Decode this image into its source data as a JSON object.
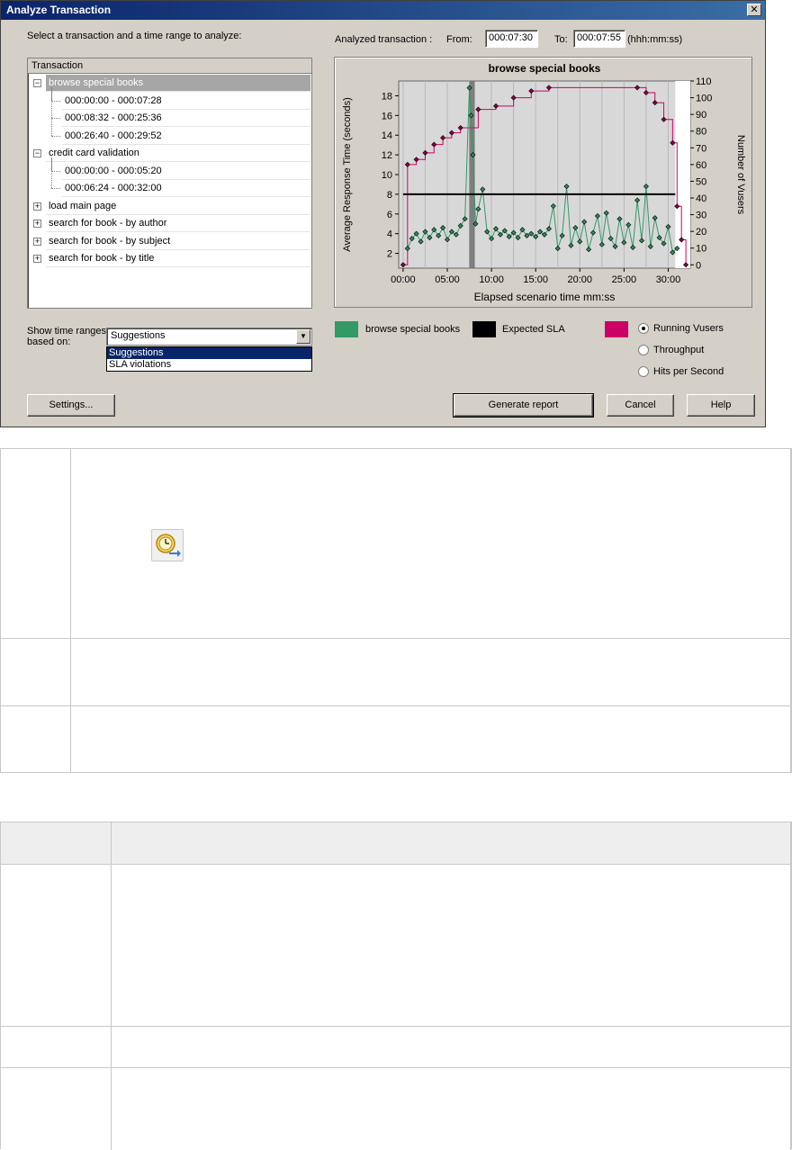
{
  "dialog": {
    "title": "Analyze Transaction",
    "close_label": "✕",
    "instructions": "Select a transaction and a time range to analyze:",
    "analyzed_label": "Analyzed transaction :",
    "from_label": "From:",
    "from_value": "000:07:30",
    "to_label": "To:",
    "to_value": "000:07:55",
    "format_hint": "(hhh:mm:ss)",
    "tree": {
      "header": "Transaction",
      "rows": [
        {
          "label": "browse special books",
          "level": 0,
          "expander": "−",
          "selected": true
        },
        {
          "label": "000:00:00 - 000:07:28",
          "level": 1
        },
        {
          "label": "000:08:32 - 000:25:36",
          "level": 1
        },
        {
          "label": "000:26:40 - 000:29:52",
          "level": 1
        },
        {
          "label": "credit card validation",
          "level": 0,
          "expander": "−"
        },
        {
          "label": "000:00:00 - 000:05:20",
          "level": 1
        },
        {
          "label": "000:06:24 - 000:32:00",
          "level": 1
        },
        {
          "label": "load main page",
          "level": 0,
          "expander": "+"
        },
        {
          "label": "search for book - by author",
          "level": 0,
          "expander": "+"
        },
        {
          "label": "search for book - by subject",
          "level": 0,
          "expander": "+"
        },
        {
          "label": "search for book - by title",
          "level": 0,
          "expander": "+"
        }
      ]
    },
    "show_ranges_label_1": "Show time ranges",
    "show_ranges_label_2": "based on:",
    "combo_value": "Suggestions",
    "dropdown_options": [
      "Suggestions",
      "SLA violations"
    ],
    "legend": {
      "series1": "browse special books",
      "series2": "Expected SLA",
      "series1_color": "#339966",
      "series2_color": "#000000",
      "series3_color": "#cc0066"
    },
    "radios": [
      {
        "label": "Running Vusers",
        "checked": true
      },
      {
        "label": "Throughput",
        "checked": false
      },
      {
        "label": "Hits per Second",
        "checked": false
      }
    ],
    "buttons": {
      "settings": "Settings...",
      "generate": "Generate report",
      "cancel": "Cancel",
      "help": "Help"
    }
  },
  "chart_data": {
    "type": "line",
    "title": "browse special books",
    "xlabel": "Elapsed scenario time mm:ss",
    "ylabel": "Average Response Time (seconds)",
    "y2label": "Number of Vusers",
    "x_ticks": [
      "00:00",
      "05:00",
      "10:00",
      "15:00",
      "20:00",
      "25:00",
      "30:00"
    ],
    "y_ticks": [
      2,
      4,
      6,
      8,
      10,
      12,
      14,
      16,
      18
    ],
    "y2_ticks": [
      0,
      10,
      20,
      30,
      40,
      50,
      60,
      70,
      80,
      90,
      100,
      110
    ],
    "xlim_minutes": [
      -0.5,
      32.5
    ],
    "ylim": [
      0.5,
      19.5
    ],
    "y2lim": [
      -2,
      110
    ],
    "sla_value": 8,
    "highlight_range_minutes": [
      7.5,
      7.92
    ],
    "series": [
      {
        "name": "Running Vusers",
        "axis": "right",
        "color": "#cc0066",
        "x": [
          0,
          0.5,
          1.5,
          2.5,
          3.5,
          4.5,
          5.5,
          6.5,
          8.5,
          10.5,
          12.5,
          14.5,
          16.5,
          26.5,
          27.5,
          28.5,
          29.5,
          30.5,
          31,
          31.5,
          32
        ],
        "y": [
          0,
          60,
          63,
          67,
          72,
          76,
          79,
          82,
          93,
          95,
          100,
          104,
          106,
          106,
          103,
          97,
          87,
          73,
          35,
          15,
          0
        ]
      },
      {
        "name": "browse special books",
        "axis": "left",
        "color": "#339966",
        "x": [
          0.5,
          1,
          1.5,
          2,
          2.5,
          3,
          3.5,
          4,
          4.5,
          5,
          5.5,
          6,
          6.5,
          7,
          7.5,
          7.7,
          7.9,
          8.2,
          8.5,
          9,
          9.5,
          10,
          10.5,
          11,
          11.5,
          12,
          12.5,
          13,
          13.5,
          14,
          14.5,
          15,
          15.5,
          16,
          16.5,
          17,
          17.5,
          18,
          18.5,
          19,
          19.5,
          20,
          20.5,
          21,
          21.5,
          22,
          22.5,
          23,
          23.5,
          24,
          24.5,
          25,
          25.5,
          26,
          26.5,
          27,
          27.5,
          28,
          28.5,
          29,
          29.5,
          30,
          30.5,
          31
        ],
        "y": [
          2.5,
          3.5,
          4,
          3.2,
          4.2,
          3.6,
          4.4,
          3.8,
          4.6,
          3.4,
          4.2,
          3.9,
          4.8,
          5.5,
          18.8,
          16,
          12,
          5,
          6.5,
          8.5,
          4.2,
          3.5,
          4.5,
          3.9,
          4.3,
          3.7,
          4.1,
          3.6,
          4.4,
          3.8,
          4.0,
          3.7,
          4.2,
          3.9,
          4.5,
          6.8,
          2.5,
          3.8,
          8.8,
          2.8,
          4.6,
          3.2,
          5.2,
          2.4,
          4.1,
          5.8,
          2.9,
          6.1,
          3.5,
          2.7,
          5.5,
          3.1,
          4.9,
          2.6,
          7.4,
          3.3,
          8.8,
          2.7,
          5.6,
          3.6,
          3.0,
          4.7,
          2.1,
          2.5
        ]
      }
    ]
  },
  "table1": {
    "rows": [
      {
        "key": "",
        "value": ""
      },
      {
        "key": "",
        "value": ""
      },
      {
        "key": "",
        "value": ""
      }
    ],
    "icon": "clock-arrow-icon"
  },
  "table2": {
    "header": [
      "",
      ""
    ],
    "rows": [
      {
        "key": "",
        "value": ""
      },
      {
        "key": "",
        "value": ""
      },
      {
        "key": "",
        "value": ""
      }
    ]
  }
}
